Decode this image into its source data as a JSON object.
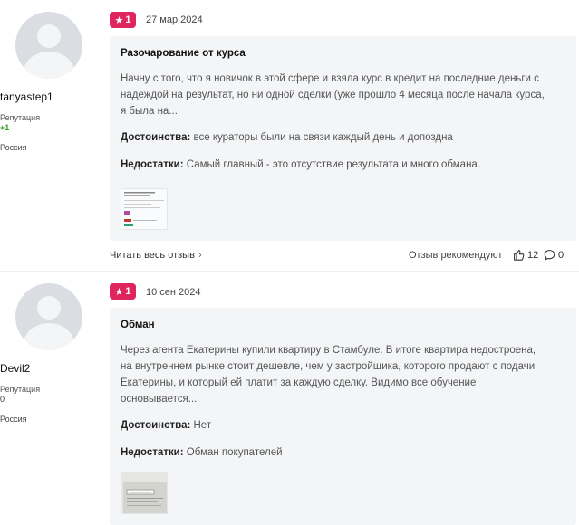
{
  "reviews": [
    {
      "user": {
        "name": "tanyastep1",
        "reputation_label": "Репутация",
        "reputation": "+1",
        "country": "Россия"
      },
      "rating": "1",
      "date": "27 мар 2024",
      "title": "Разочарование от курса",
      "text": "Начну с того, что я новичок в этой сфере и взяла курс в кредит на последние деньги с надеждой на результат, но ни одной сделки (уже прошло 4 месяца после начала курса, я была на...",
      "pros_label": "Достоинства:",
      "pros": "все кураторы были на связи каждый день и допоздна",
      "cons_label": "Недостатки:",
      "cons": "Самый главный - это отсутствие результата и много обмана.",
      "read_more": "Читать весь отзыв",
      "recommend_label": "Отзыв рекомендуют",
      "likes": "12",
      "comments": "0"
    },
    {
      "user": {
        "name": "Devil2",
        "reputation_label": "Репутация",
        "reputation": "0",
        "country": "Россия"
      },
      "rating": "1",
      "date": "10 сен 2024",
      "title": "Обман",
      "text": "Через агента Екатерины купили квартиру в Стамбуле. В итоге квартира недостроена, на внутреннем рынке стоит дешевле, чем у застройщика, которого продают с подачи Екатерины, и который ей платит за каждую сделку. Видимо все обучение основывается...",
      "pros_label": "Достоинства:",
      "pros": "Нет",
      "cons_label": "Недостатки:",
      "cons": "Обман покупателей"
    }
  ],
  "colors": {
    "badge": "#e0245e",
    "box_bg": "#f4f5f7",
    "positive_rep": "#3a9a2e"
  }
}
